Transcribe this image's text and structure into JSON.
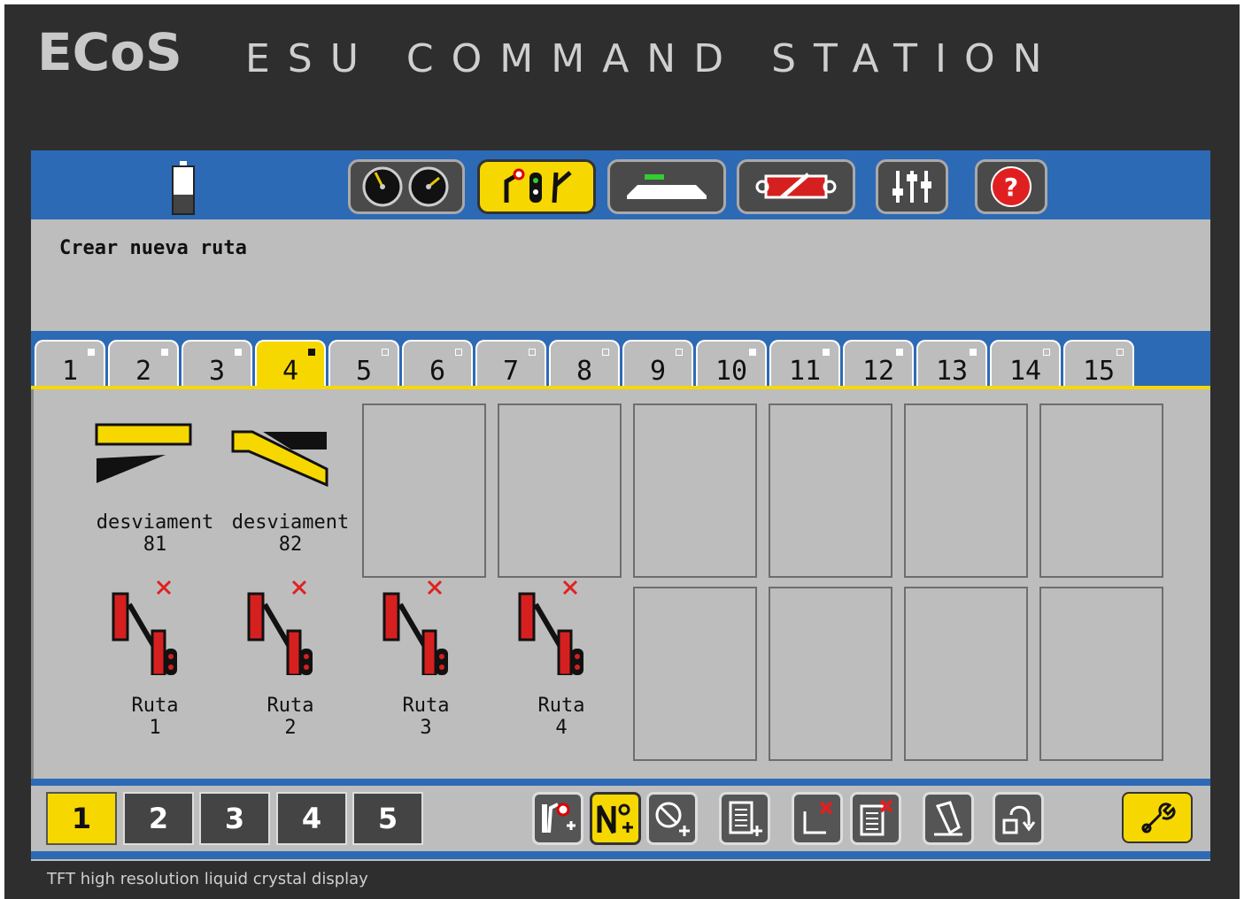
{
  "header": {
    "logo": "ECoS",
    "brand": "ESU COMMAND STATION"
  },
  "toolbar": {
    "battery_icon": "battery-icon",
    "buttons": [
      {
        "icon": "speedometer-icon",
        "active": false
      },
      {
        "icon": "signal-switch-icon",
        "active": true
      },
      {
        "icon": "track-layout-icon",
        "active": false
      },
      {
        "icon": "programming-icon",
        "active": false
      },
      {
        "icon": "sliders-icon",
        "active": false
      },
      {
        "icon": "help-icon",
        "active": false
      }
    ]
  },
  "message": "Crear nueva ruta",
  "tabs": [
    {
      "label": "1",
      "indicator": "filled"
    },
    {
      "label": "2",
      "indicator": "filled"
    },
    {
      "label": "3",
      "indicator": "filled"
    },
    {
      "label": "4",
      "indicator": "filled",
      "active": true
    },
    {
      "label": "5",
      "indicator": "empty"
    },
    {
      "label": "6",
      "indicator": "empty"
    },
    {
      "label": "7",
      "indicator": "empty"
    },
    {
      "label": "8",
      "indicator": "empty"
    },
    {
      "label": "9",
      "indicator": "empty"
    },
    {
      "label": "10",
      "indicator": "filled"
    },
    {
      "label": "11",
      "indicator": "filled"
    },
    {
      "label": "12",
      "indicator": "filled"
    },
    {
      "label": "13",
      "indicator": "filled"
    },
    {
      "label": "14",
      "indicator": "empty"
    },
    {
      "label": "15",
      "indicator": "empty"
    }
  ],
  "items": [
    {
      "name": "desviament",
      "number": "81",
      "icon": "turnout-left-icon"
    },
    {
      "name": "desviament",
      "number": "82",
      "icon": "turnout-right-icon"
    },
    {
      "name": "Ruta",
      "number": "1",
      "icon": "route-icon"
    },
    {
      "name": "Ruta",
      "number": "2",
      "icon": "route-icon"
    },
    {
      "name": "Ruta",
      "number": "3",
      "icon": "route-icon"
    },
    {
      "name": "Ruta",
      "number": "4",
      "icon": "route-icon"
    }
  ],
  "pages": [
    {
      "label": "1",
      "active": true
    },
    {
      "label": "2"
    },
    {
      "label": "3"
    },
    {
      "label": "4"
    },
    {
      "label": "5"
    }
  ],
  "actions": [
    {
      "icon": "add-signal-icon"
    },
    {
      "icon": "add-route-icon",
      "active": true
    },
    {
      "icon": "add-stop-icon"
    },
    {
      "icon": "add-list-icon"
    },
    {
      "icon": "delete-icon"
    },
    {
      "icon": "delete-list-icon"
    },
    {
      "icon": "edit-icon"
    },
    {
      "icon": "move-icon"
    },
    {
      "icon": "wrench-icon"
    }
  ],
  "footer": "TFT high resolution liquid crystal display"
}
